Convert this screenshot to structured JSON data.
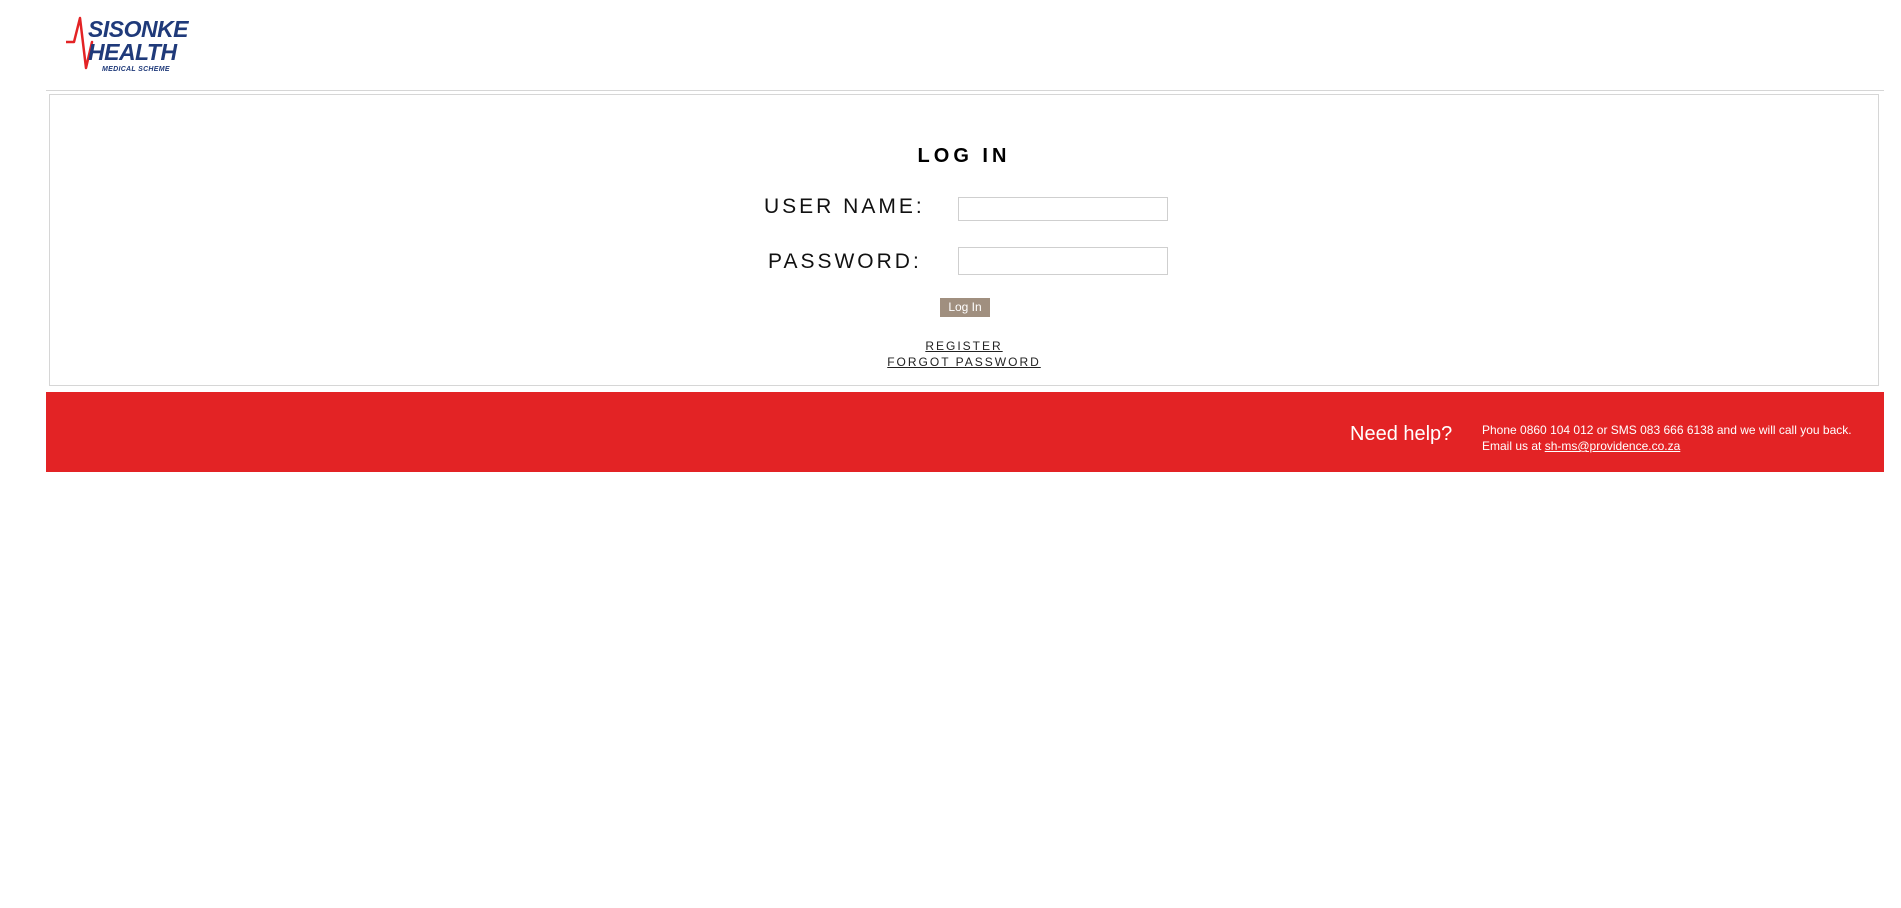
{
  "logo": {
    "line1": "SISONKE",
    "line2": "HEALTH",
    "line3": "MEDICAL SCHEME",
    "accent_color": "#e32325",
    "text_color": "#1f3a7a"
  },
  "login": {
    "title": "LOG IN",
    "username_label": "USER NAME:",
    "username_value": "",
    "password_label": "PASSWORD:",
    "password_value": "",
    "submit_label": "Log In",
    "register_link": "REGISTER",
    "forgot_link": "FORGOT PASSWORD"
  },
  "footer": {
    "need_help": "Need help?",
    "phone_text": "Phone 0860 104 012 or SMS 083 666 6138 and we will call you back.",
    "email_prefix": "Email us at ",
    "email": "sh-ms@providence.co.za",
    "background_color": "#e32325"
  }
}
